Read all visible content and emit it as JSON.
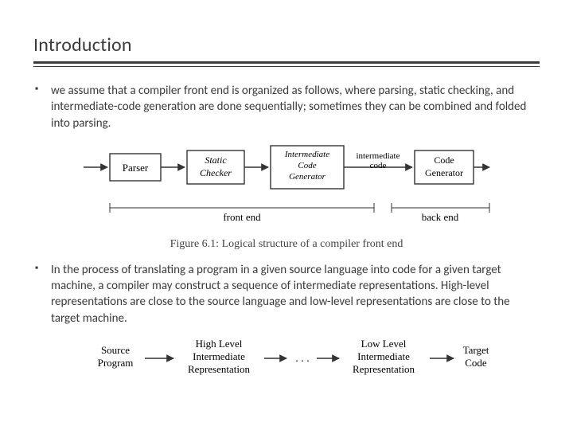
{
  "title": "Introduction",
  "bullets": [
    "we assume that a compiler front end is organized as follows, where parsing, static checking, and intermediate-code generation are done sequentially; sometimes they can be combined and folded into parsing.",
    "In the process of translating a program in a given source language into code for a given target machine, a compiler may construct a sequence of intermediate representations. High-level representations are close to the source language and low-level representations are close to the target machine."
  ],
  "figure1": {
    "boxes": [
      "Parser",
      "Static\nChecker",
      "Intermediate\nCode\nGenerator",
      "Code\nGenerator"
    ],
    "mid_label": "intermediate\ncode",
    "front_label": "front end",
    "back_label": "back end",
    "caption": "Figure 6.1: Logical structure of a compiler front end"
  },
  "figure2": {
    "nodes": [
      "Source\nProgram",
      "High Level\nIntermediate\nRepresentation",
      "Low Level\nIntermediate\nRepresentation",
      "Target\nCode"
    ],
    "ellipsis": ". . ."
  }
}
